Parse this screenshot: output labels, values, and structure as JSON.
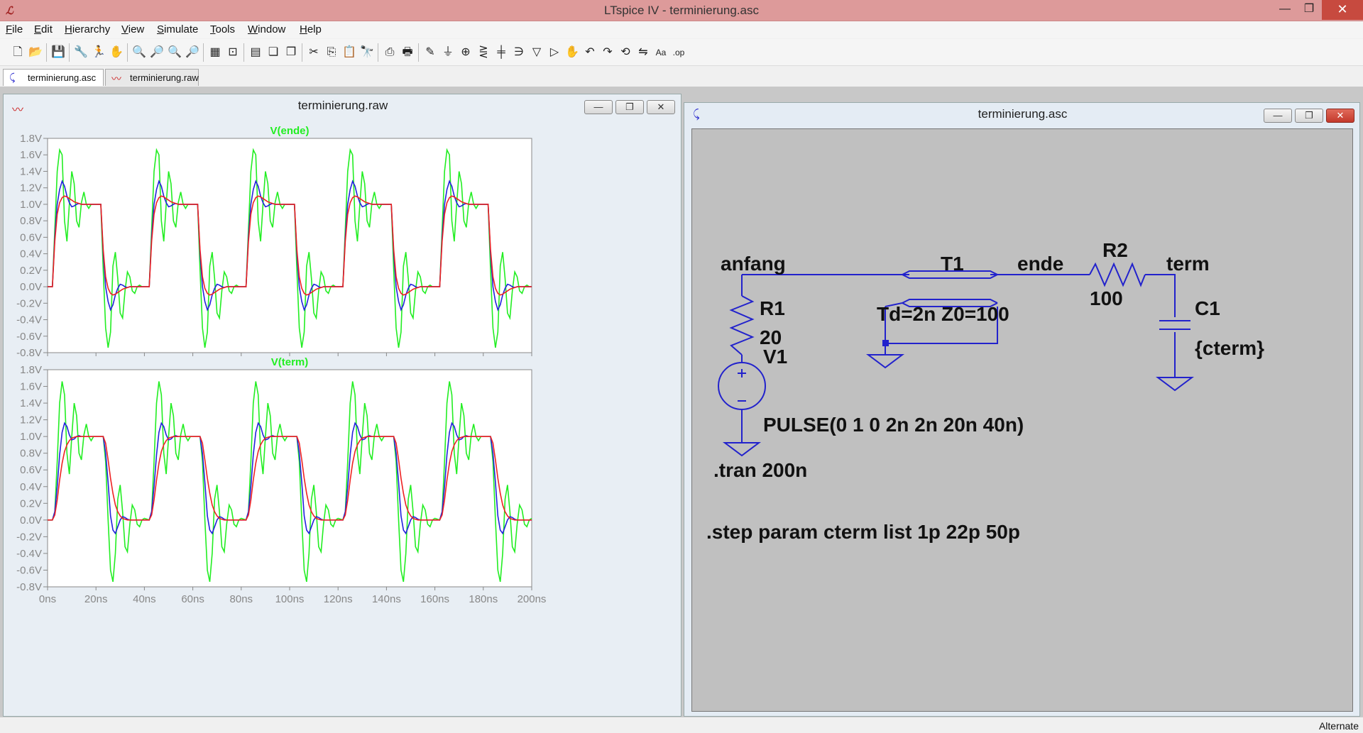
{
  "window": {
    "title": "LTspice IV - terminierung.asc",
    "minimize_glyph": "—",
    "maximize_glyph": "❐",
    "close_glyph": "✕",
    "app_icon": "ltspice-logo"
  },
  "menu": [
    "File",
    "Edit",
    "Hierarchy",
    "View",
    "Simulate",
    "Tools",
    "Window",
    "Help"
  ],
  "toolbar": [
    {
      "icon": "new-schematic-icon",
      "glyph": "🗋"
    },
    {
      "icon": "open-icon",
      "glyph": "📂"
    },
    {
      "icon": "save-icon",
      "glyph": "💾"
    },
    {
      "icon": "control-panel-icon",
      "glyph": "🔧"
    },
    {
      "icon": "run-icon",
      "glyph": "🏃"
    },
    {
      "icon": "halt-icon",
      "glyph": "✋"
    },
    {
      "icon": "zoom-in-icon",
      "glyph": "🔍"
    },
    {
      "icon": "pan-icon",
      "glyph": "🔎"
    },
    {
      "icon": "zoom-out-icon",
      "glyph": "🔍"
    },
    {
      "icon": "zoom-fit-icon",
      "glyph": "🔎"
    },
    {
      "icon": "autorange-icon",
      "glyph": "▦"
    },
    {
      "icon": "mark-icon",
      "glyph": "⊡"
    },
    {
      "icon": "tile-horizontal-icon",
      "glyph": "▤"
    },
    {
      "icon": "cascade-icon",
      "glyph": "❏"
    },
    {
      "icon": "tile-vertical-icon",
      "glyph": "❐"
    },
    {
      "icon": "cut-icon",
      "glyph": "✂"
    },
    {
      "icon": "copy-icon",
      "glyph": "⎘"
    },
    {
      "icon": "paste-icon",
      "glyph": "📋"
    },
    {
      "icon": "find-icon",
      "glyph": "🔭"
    },
    {
      "icon": "print-setup-icon",
      "glyph": "⎙"
    },
    {
      "icon": "print-icon",
      "glyph": "🖶"
    },
    {
      "icon": "draw-wire-icon",
      "glyph": "✎"
    },
    {
      "icon": "ground-icon",
      "glyph": "⏚"
    },
    {
      "icon": "label-net-icon",
      "glyph": "⊕"
    },
    {
      "icon": "resistor-icon",
      "glyph": "⋛"
    },
    {
      "icon": "capacitor-icon",
      "glyph": "╪"
    },
    {
      "icon": "inductor-icon",
      "glyph": "∋"
    },
    {
      "icon": "diode-icon",
      "glyph": "▽"
    },
    {
      "icon": "component-icon",
      "glyph": "▷"
    },
    {
      "icon": "move-icon",
      "glyph": "✋"
    },
    {
      "icon": "undo-icon",
      "glyph": "↶"
    },
    {
      "icon": "redo-icon",
      "glyph": "↷"
    },
    {
      "icon": "rotate-icon",
      "glyph": "⟲"
    },
    {
      "icon": "mirror-icon",
      "glyph": "⇋"
    },
    {
      "icon": "text-icon",
      "glyph": "Aa"
    },
    {
      "icon": "spice-directive-icon",
      "glyph": ".op"
    }
  ],
  "tabs": [
    {
      "label": "terminierung.asc",
      "icon": "schematic-icon",
      "active": true
    },
    {
      "label": "terminierung.raw",
      "icon": "waveform-icon",
      "active": false
    }
  ],
  "waveform_window": {
    "title": "terminierung.raw",
    "minimize_glyph": "—",
    "restore_glyph": "❐",
    "close_glyph": "✕"
  },
  "schematic_window": {
    "title": "terminierung.asc",
    "minimize_glyph": "—",
    "restore_glyph": "❐",
    "close_glyph": "✕"
  },
  "schematic": {
    "labels": {
      "net_anfang": "anfang",
      "net_ende": "ende",
      "net_term": "term",
      "t1_name": "T1",
      "t1_value": "Td=2n Z0=100",
      "r1_name": "R1",
      "r1_value": "20",
      "v1_name": "V1",
      "v1_value": "PULSE(0 1 0 2n 2n 20n 40n)",
      "r2_name": "R2",
      "r2_value": "100",
      "c1_name": "C1",
      "c1_value": "{cterm}",
      "directive_tran": ".tran 200n",
      "directive_step": ".step param cterm list 1p 22p 50p"
    },
    "colors": {
      "wire": "#2222cc",
      "background": "#c0c0c0",
      "text": "#111111"
    }
  },
  "status": {
    "text": "Alternate"
  },
  "chart_data": [
    {
      "type": "line",
      "title": "V(ende)",
      "x_ticks": [
        "0ns",
        "20ns",
        "40ns",
        "60ns",
        "80ns",
        "100ns",
        "120ns",
        "140ns",
        "160ns",
        "180ns",
        "200ns"
      ],
      "y_ticks": [
        "1.8V",
        "1.6V",
        "1.4V",
        "1.2V",
        "1.0V",
        "0.8V",
        "0.6V",
        "0.4V",
        "0.2V",
        "0.0V",
        "-0.2V",
        "-0.4V",
        "-0.6V",
        "-0.8V"
      ],
      "xlim": [
        0,
        200
      ],
      "ylim": [
        -0.8,
        1.8
      ],
      "grid": false,
      "series": [
        {
          "color": "#22ee22",
          "step": "1p",
          "x": [
            0,
            2,
            3,
            4,
            5,
            6,
            7,
            8,
            9,
            10,
            11,
            12,
            13,
            14,
            15,
            16,
            17,
            18,
            19,
            20,
            21,
            22,
            23,
            24,
            25,
            26,
            27,
            28,
            29,
            30,
            31,
            32,
            33,
            34,
            35,
            36,
            37,
            38,
            39,
            40
          ],
          "y": [
            0,
            0,
            0.7,
            1.4,
            1.66,
            1.6,
            0.8,
            0.55,
            1.0,
            1.4,
            1.25,
            0.8,
            0.72,
            1.02,
            1.15,
            1.0,
            0.95,
            1.0,
            1.0,
            1.0,
            1.0,
            1.0,
            0.2,
            -0.5,
            -0.74,
            -0.55,
            0.25,
            0.42,
            0.1,
            -0.32,
            -0.38,
            -0.05,
            0.18,
            0.12,
            -0.05,
            -0.08,
            0.0,
            0.02,
            0.0,
            0.0
          ]
        },
        {
          "color": "#2222dd",
          "step": "22p",
          "x": [
            0,
            2,
            3,
            4,
            5,
            6,
            7,
            8,
            9,
            10,
            11,
            12,
            13,
            14,
            15,
            16,
            17,
            18,
            19,
            20,
            21,
            22,
            23,
            24,
            25,
            26,
            27,
            28,
            29,
            30,
            31,
            32,
            33,
            34,
            35,
            36,
            37,
            38,
            39,
            40
          ],
          "y": [
            0,
            0,
            0.6,
            1.0,
            1.18,
            1.28,
            1.22,
            1.1,
            1.02,
            0.97,
            0.98,
            1.0,
            1.01,
            1.0,
            1.0,
            1.0,
            1.0,
            1.0,
            1.0,
            1.0,
            1.0,
            1.0,
            0.4,
            0.0,
            -0.18,
            -0.28,
            -0.22,
            -0.1,
            -0.02,
            0.03,
            0.02,
            0.0,
            -0.01,
            0.0,
            0.0,
            0.0,
            0.0,
            0.0,
            0.0,
            0.0
          ]
        },
        {
          "color": "#ee2222",
          "step": "50p",
          "x": [
            0,
            2,
            3,
            4,
            5,
            6,
            7,
            8,
            9,
            10,
            11,
            12,
            13,
            14,
            15,
            16,
            17,
            18,
            19,
            20,
            21,
            22,
            23,
            24,
            25,
            26,
            27,
            28,
            29,
            30,
            31,
            32,
            33,
            34,
            35,
            36,
            37,
            38,
            39,
            40
          ],
          "y": [
            0,
            0,
            0.55,
            0.88,
            1.02,
            1.08,
            1.1,
            1.09,
            1.07,
            1.05,
            1.03,
            1.02,
            1.01,
            1.0,
            1.0,
            1.0,
            1.0,
            1.0,
            1.0,
            1.0,
            1.0,
            1.0,
            0.45,
            0.12,
            -0.02,
            -0.08,
            -0.1,
            -0.09,
            -0.07,
            -0.05,
            -0.03,
            -0.02,
            -0.01,
            0.0,
            0.0,
            0.0,
            0.0,
            0.0,
            0.0,
            0.0
          ]
        }
      ]
    },
    {
      "type": "line",
      "title": "V(term)",
      "x_ticks": [
        "0ns",
        "20ns",
        "40ns",
        "60ns",
        "80ns",
        "100ns",
        "120ns",
        "140ns",
        "160ns",
        "180ns",
        "200ns"
      ],
      "y_ticks": [
        "1.8V",
        "1.6V",
        "1.4V",
        "1.2V",
        "1.0V",
        "0.8V",
        "0.6V",
        "0.4V",
        "0.2V",
        "0.0V",
        "-0.2V",
        "-0.4V",
        "-0.6V",
        "-0.8V"
      ],
      "xlim": [
        0,
        200
      ],
      "ylim": [
        -0.8,
        1.8
      ],
      "grid": false,
      "series": [
        {
          "color": "#22ee22",
          "step": "1p",
          "x": [
            0,
            2,
            3,
            4,
            5,
            6,
            7,
            8,
            9,
            10,
            11,
            12,
            13,
            14,
            15,
            16,
            17,
            18,
            19,
            20,
            21,
            22,
            23,
            24,
            25,
            26,
            27,
            28,
            29,
            30,
            31,
            32,
            33,
            34,
            35,
            36,
            37,
            38,
            39,
            40
          ],
          "y": [
            0,
            0,
            0.1,
            0.7,
            1.4,
            1.66,
            1.5,
            0.8,
            0.55,
            1.0,
            1.4,
            1.25,
            0.8,
            0.72,
            1.02,
            1.15,
            1.0,
            0.95,
            1.0,
            1.0,
            1.0,
            1.0,
            1.0,
            0.7,
            0.0,
            -0.6,
            -0.74,
            -0.4,
            0.25,
            0.42,
            0.1,
            -0.32,
            -0.38,
            -0.05,
            0.18,
            0.12,
            -0.05,
            -0.08,
            0.0,
            0.02
          ]
        },
        {
          "color": "#2222dd",
          "step": "22p",
          "x": [
            0,
            2,
            3,
            4,
            5,
            6,
            7,
            8,
            9,
            10,
            11,
            12,
            13,
            14,
            15,
            16,
            17,
            18,
            19,
            20,
            21,
            22,
            23,
            24,
            25,
            26,
            27,
            28,
            29,
            30,
            31,
            32,
            33,
            34,
            35,
            36,
            37,
            38,
            39,
            40
          ],
          "y": [
            0,
            0,
            0.1,
            0.4,
            0.78,
            1.05,
            1.16,
            1.12,
            1.02,
            0.96,
            0.97,
            1.0,
            1.01,
            1.0,
            1.0,
            1.0,
            1.0,
            1.0,
            1.0,
            1.0,
            1.0,
            1.0,
            1.0,
            0.8,
            0.45,
            0.05,
            -0.12,
            -0.16,
            -0.08,
            0.0,
            0.04,
            0.03,
            0.01,
            0.0,
            0.0,
            0.0,
            0.0,
            0.0,
            0.0,
            0.0
          ]
        },
        {
          "color": "#ee2222",
          "step": "50p",
          "x": [
            0,
            2,
            3,
            4,
            5,
            6,
            7,
            8,
            9,
            10,
            11,
            12,
            13,
            14,
            15,
            16,
            17,
            18,
            19,
            20,
            21,
            22,
            23,
            24,
            25,
            26,
            27,
            28,
            29,
            30,
            31,
            32,
            33,
            34,
            35,
            36,
            37,
            38,
            39,
            40
          ],
          "y": [
            0,
            0,
            0.06,
            0.24,
            0.48,
            0.68,
            0.82,
            0.9,
            0.95,
            0.98,
            0.99,
            1.0,
            1.0,
            1.0,
            1.0,
            1.0,
            1.0,
            1.0,
            1.0,
            1.0,
            1.0,
            1.0,
            1.0,
            0.92,
            0.72,
            0.5,
            0.32,
            0.18,
            0.1,
            0.05,
            0.02,
            0.01,
            0.0,
            0.0,
            0.0,
            0.0,
            0.0,
            0.0,
            0.0,
            0.0
          ]
        }
      ]
    }
  ]
}
